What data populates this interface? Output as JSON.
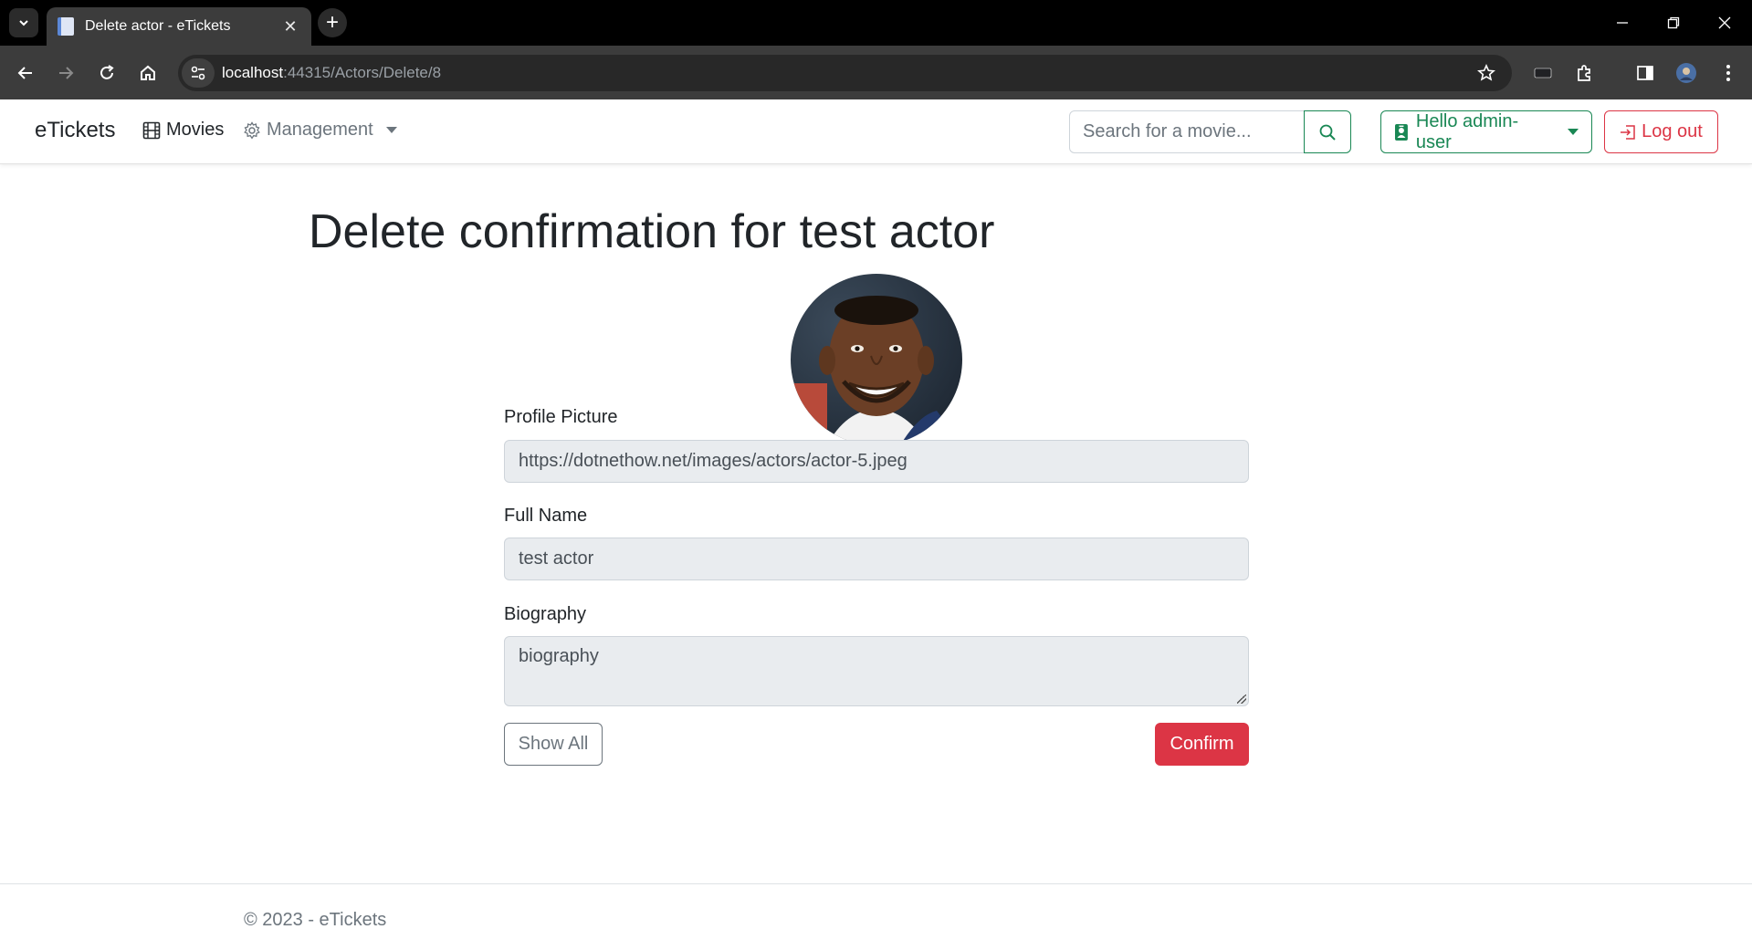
{
  "browser": {
    "tab_title": "Delete actor - eTickets",
    "url_host": "localhost",
    "url_path": ":44315/Actors/Delete/8"
  },
  "navbar": {
    "brand": "eTickets",
    "movies_label": "Movies",
    "management_label": "Management",
    "search_placeholder": "Search for a movie...",
    "user_label": "Hello admin-user",
    "logout_label": "Log out"
  },
  "page": {
    "title": "Delete confirmation for test actor",
    "fields": {
      "profile_picture_label": "Profile Picture",
      "profile_picture_value": "https://dotnethow.net/images/actors/actor-5.jpeg",
      "full_name_label": "Full Name",
      "full_name_value": "test actor",
      "biography_label": "Biography",
      "biography_value": "biography"
    },
    "show_all_label": "Show All",
    "confirm_label": "Confirm"
  },
  "footer": {
    "text": "© 2023 - eTickets"
  },
  "colors": {
    "success": "#198754",
    "danger": "#dc3545",
    "secondary": "#6c757d"
  }
}
